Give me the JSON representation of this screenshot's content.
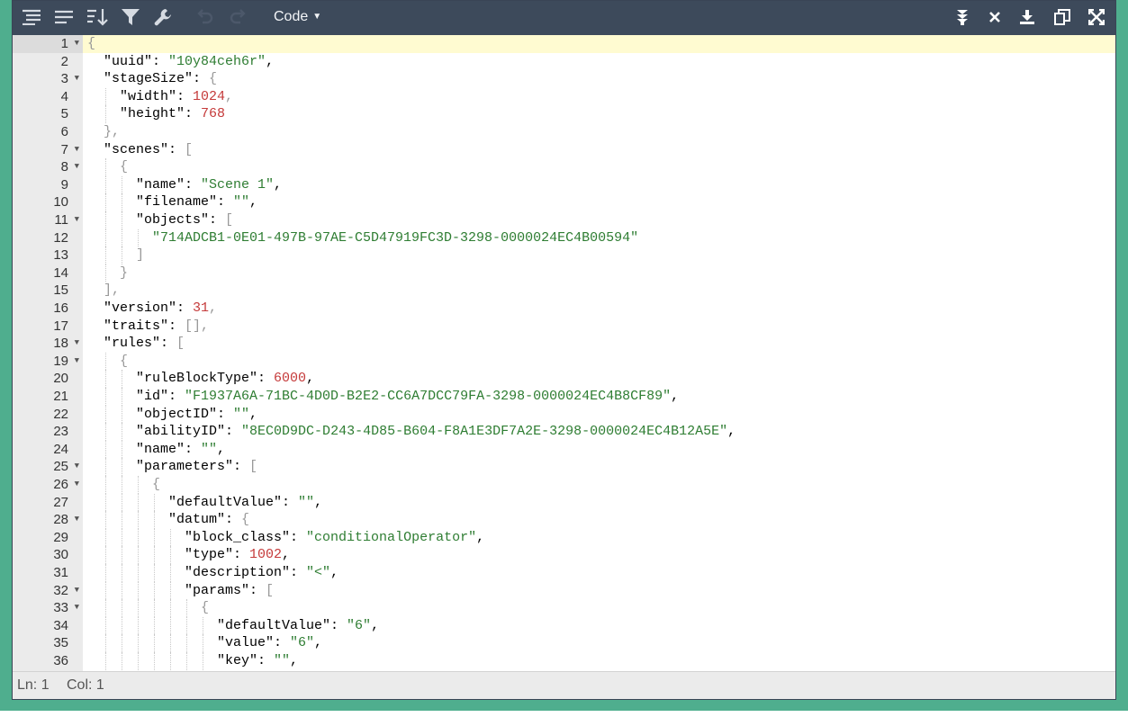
{
  "toolbar": {
    "buttons": [
      {
        "name": "format-button",
        "icon": "format-icon"
      },
      {
        "name": "compact-button",
        "icon": "compact-icon"
      },
      {
        "name": "sort-button",
        "icon": "sort-icon"
      },
      {
        "name": "filter-button",
        "icon": "filter-icon"
      },
      {
        "name": "repair-button",
        "icon": "wrench-icon"
      },
      {
        "name": "undo-button",
        "icon": "undo-icon"
      },
      {
        "name": "redo-button",
        "icon": "redo-icon"
      }
    ],
    "mode_label": "Code",
    "right_buttons": [
      {
        "name": "transform-button",
        "icon": "transform-icon"
      },
      {
        "name": "clear-button",
        "icon": "close-icon"
      },
      {
        "name": "download-button",
        "icon": "download-icon"
      },
      {
        "name": "copy-button",
        "icon": "copy-icon"
      },
      {
        "name": "fullscreen-button",
        "icon": "fullscreen-icon"
      }
    ]
  },
  "status": {
    "ln": "Ln: 1",
    "col": "Col: 1"
  },
  "colors": {
    "background": "#4fae8e",
    "toolbar": "#3d4a5b",
    "string": "#2e7d32",
    "number": "#c53a3a",
    "active_line": "#fffbd1"
  },
  "lines": [
    {
      "n": "1",
      "fold": true,
      "indent": 0,
      "tokens": [
        [
          "p",
          "{"
        ]
      ]
    },
    {
      "n": "2",
      "fold": false,
      "indent": 1,
      "tokens": [
        [
          "k",
          "\"uuid\""
        ],
        [
          "k",
          ": "
        ],
        [
          "s",
          "\"10y84ceh6r\""
        ],
        [
          "k",
          ","
        ]
      ]
    },
    {
      "n": "3",
      "fold": true,
      "indent": 1,
      "tokens": [
        [
          "k",
          "\"stageSize\""
        ],
        [
          "k",
          ": "
        ],
        [
          "p",
          "{"
        ]
      ]
    },
    {
      "n": "4",
      "fold": false,
      "indent": 2,
      "tokens": [
        [
          "k",
          "\"width\""
        ],
        [
          "k",
          ": "
        ],
        [
          "n",
          "1024"
        ],
        [
          "p",
          ","
        ]
      ]
    },
    {
      "n": "5",
      "fold": false,
      "indent": 2,
      "tokens": [
        [
          "k",
          "\"height\""
        ],
        [
          "k",
          ": "
        ],
        [
          "n",
          "768"
        ]
      ]
    },
    {
      "n": "6",
      "fold": false,
      "indent": 1,
      "tokens": [
        [
          "p",
          "},"
        ]
      ]
    },
    {
      "n": "7",
      "fold": true,
      "indent": 1,
      "tokens": [
        [
          "k",
          "\"scenes\""
        ],
        [
          "k",
          ": "
        ],
        [
          "p",
          "["
        ]
      ]
    },
    {
      "n": "8",
      "fold": true,
      "indent": 2,
      "tokens": [
        [
          "p",
          "{"
        ]
      ]
    },
    {
      "n": "9",
      "fold": false,
      "indent": 3,
      "tokens": [
        [
          "k",
          "\"name\""
        ],
        [
          "k",
          ": "
        ],
        [
          "s",
          "\"Scene 1\""
        ],
        [
          "k",
          ","
        ]
      ]
    },
    {
      "n": "10",
      "fold": false,
      "indent": 3,
      "tokens": [
        [
          "k",
          "\"filename\""
        ],
        [
          "k",
          ": "
        ],
        [
          "s",
          "\"\""
        ],
        [
          "k",
          ","
        ]
      ]
    },
    {
      "n": "11",
      "fold": true,
      "indent": 3,
      "tokens": [
        [
          "k",
          "\"objects\""
        ],
        [
          "k",
          ": "
        ],
        [
          "p",
          "["
        ]
      ]
    },
    {
      "n": "12",
      "fold": false,
      "indent": 4,
      "tokens": [
        [
          "s",
          "\"714ADCB1-0E01-497B-97AE-C5D47919FC3D-3298-0000024EC4B00594\""
        ]
      ]
    },
    {
      "n": "13",
      "fold": false,
      "indent": 3,
      "tokens": [
        [
          "p",
          "]"
        ]
      ]
    },
    {
      "n": "14",
      "fold": false,
      "indent": 2,
      "tokens": [
        [
          "p",
          "}"
        ]
      ]
    },
    {
      "n": "15",
      "fold": false,
      "indent": 1,
      "tokens": [
        [
          "p",
          "],"
        ]
      ]
    },
    {
      "n": "16",
      "fold": false,
      "indent": 1,
      "tokens": [
        [
          "k",
          "\"version\""
        ],
        [
          "k",
          ": "
        ],
        [
          "n",
          "31"
        ],
        [
          "p",
          ","
        ]
      ]
    },
    {
      "n": "17",
      "fold": false,
      "indent": 1,
      "tokens": [
        [
          "k",
          "\"traits\""
        ],
        [
          "k",
          ": "
        ],
        [
          "p",
          "[],"
        ]
      ]
    },
    {
      "n": "18",
      "fold": true,
      "indent": 1,
      "tokens": [
        [
          "k",
          "\"rules\""
        ],
        [
          "k",
          ": "
        ],
        [
          "p",
          "["
        ]
      ]
    },
    {
      "n": "19",
      "fold": true,
      "indent": 2,
      "tokens": [
        [
          "p",
          "{"
        ]
      ]
    },
    {
      "n": "20",
      "fold": false,
      "indent": 3,
      "tokens": [
        [
          "k",
          "\"ruleBlockType\""
        ],
        [
          "k",
          ": "
        ],
        [
          "n",
          "6000"
        ],
        [
          "k",
          ","
        ]
      ]
    },
    {
      "n": "21",
      "fold": false,
      "indent": 3,
      "tokens": [
        [
          "k",
          "\"id\""
        ],
        [
          "k",
          ": "
        ],
        [
          "s",
          "\"F1937A6A-71BC-4D0D-B2E2-CC6A7DCC79FA-3298-0000024EC4B8CF89\""
        ],
        [
          "k",
          ","
        ]
      ]
    },
    {
      "n": "22",
      "fold": false,
      "indent": 3,
      "tokens": [
        [
          "k",
          "\"objectID\""
        ],
        [
          "k",
          ": "
        ],
        [
          "s",
          "\"\""
        ],
        [
          "k",
          ","
        ]
      ]
    },
    {
      "n": "23",
      "fold": false,
      "indent": 3,
      "tokens": [
        [
          "k",
          "\"abilityID\""
        ],
        [
          "k",
          ": "
        ],
        [
          "s",
          "\"8EC0D9DC-D243-4D85-B604-F8A1E3DF7A2E-3298-0000024EC4B12A5E\""
        ],
        [
          "k",
          ","
        ]
      ]
    },
    {
      "n": "24",
      "fold": false,
      "indent": 3,
      "tokens": [
        [
          "k",
          "\"name\""
        ],
        [
          "k",
          ": "
        ],
        [
          "s",
          "\"\""
        ],
        [
          "k",
          ","
        ]
      ]
    },
    {
      "n": "25",
      "fold": true,
      "indent": 3,
      "tokens": [
        [
          "k",
          "\"parameters\""
        ],
        [
          "k",
          ": "
        ],
        [
          "p",
          "["
        ]
      ]
    },
    {
      "n": "26",
      "fold": true,
      "indent": 4,
      "tokens": [
        [
          "p",
          "{"
        ]
      ]
    },
    {
      "n": "27",
      "fold": false,
      "indent": 5,
      "tokens": [
        [
          "k",
          "\"defaultValue\""
        ],
        [
          "k",
          ": "
        ],
        [
          "s",
          "\"\""
        ],
        [
          "k",
          ","
        ]
      ]
    },
    {
      "n": "28",
      "fold": true,
      "indent": 5,
      "tokens": [
        [
          "k",
          "\"datum\""
        ],
        [
          "k",
          ": "
        ],
        [
          "p",
          "{"
        ]
      ]
    },
    {
      "n": "29",
      "fold": false,
      "indent": 6,
      "tokens": [
        [
          "k",
          "\"block_class\""
        ],
        [
          "k",
          ": "
        ],
        [
          "s",
          "\"conditionalOperator\""
        ],
        [
          "k",
          ","
        ]
      ]
    },
    {
      "n": "30",
      "fold": false,
      "indent": 6,
      "tokens": [
        [
          "k",
          "\"type\""
        ],
        [
          "k",
          ": "
        ],
        [
          "n",
          "1002"
        ],
        [
          "k",
          ","
        ]
      ]
    },
    {
      "n": "31",
      "fold": false,
      "indent": 6,
      "tokens": [
        [
          "k",
          "\"description\""
        ],
        [
          "k",
          ": "
        ],
        [
          "s",
          "\"<\""
        ],
        [
          "k",
          ","
        ]
      ]
    },
    {
      "n": "32",
      "fold": true,
      "indent": 6,
      "tokens": [
        [
          "k",
          "\"params\""
        ],
        [
          "k",
          ": "
        ],
        [
          "p",
          "["
        ]
      ]
    },
    {
      "n": "33",
      "fold": true,
      "indent": 7,
      "tokens": [
        [
          "p",
          "{"
        ]
      ]
    },
    {
      "n": "34",
      "fold": false,
      "indent": 8,
      "tokens": [
        [
          "k",
          "\"defaultValue\""
        ],
        [
          "k",
          ": "
        ],
        [
          "s",
          "\"6\""
        ],
        [
          "k",
          ","
        ]
      ]
    },
    {
      "n": "35",
      "fold": false,
      "indent": 8,
      "tokens": [
        [
          "k",
          "\"value\""
        ],
        [
          "k",
          ": "
        ],
        [
          "s",
          "\"6\""
        ],
        [
          "k",
          ","
        ]
      ]
    },
    {
      "n": "36",
      "fold": false,
      "indent": 8,
      "tokens": [
        [
          "k",
          "\"key\""
        ],
        [
          "k",
          ": "
        ],
        [
          "s",
          "\"\""
        ],
        [
          "k",
          ","
        ]
      ]
    }
  ]
}
